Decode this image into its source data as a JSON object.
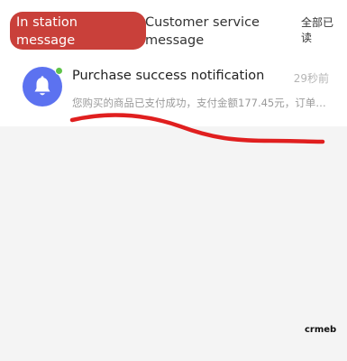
{
  "tabs": {
    "station": "In station message",
    "customer_service": "Customer service message",
    "read_all": "全部已读"
  },
  "notification": {
    "title": "Purchase success notification",
    "time": "29秒前",
    "snippet": "您购买的商品已支付成功，支付金额177.45元，订单号...",
    "icon": "bell-icon",
    "unread_dot_color": "#5fc349",
    "avatar_color": "#5c72f0"
  },
  "watermark": "crmeb",
  "colors": {
    "active_tab": "#c9403a",
    "annotation_underline": "#e01f1f"
  }
}
